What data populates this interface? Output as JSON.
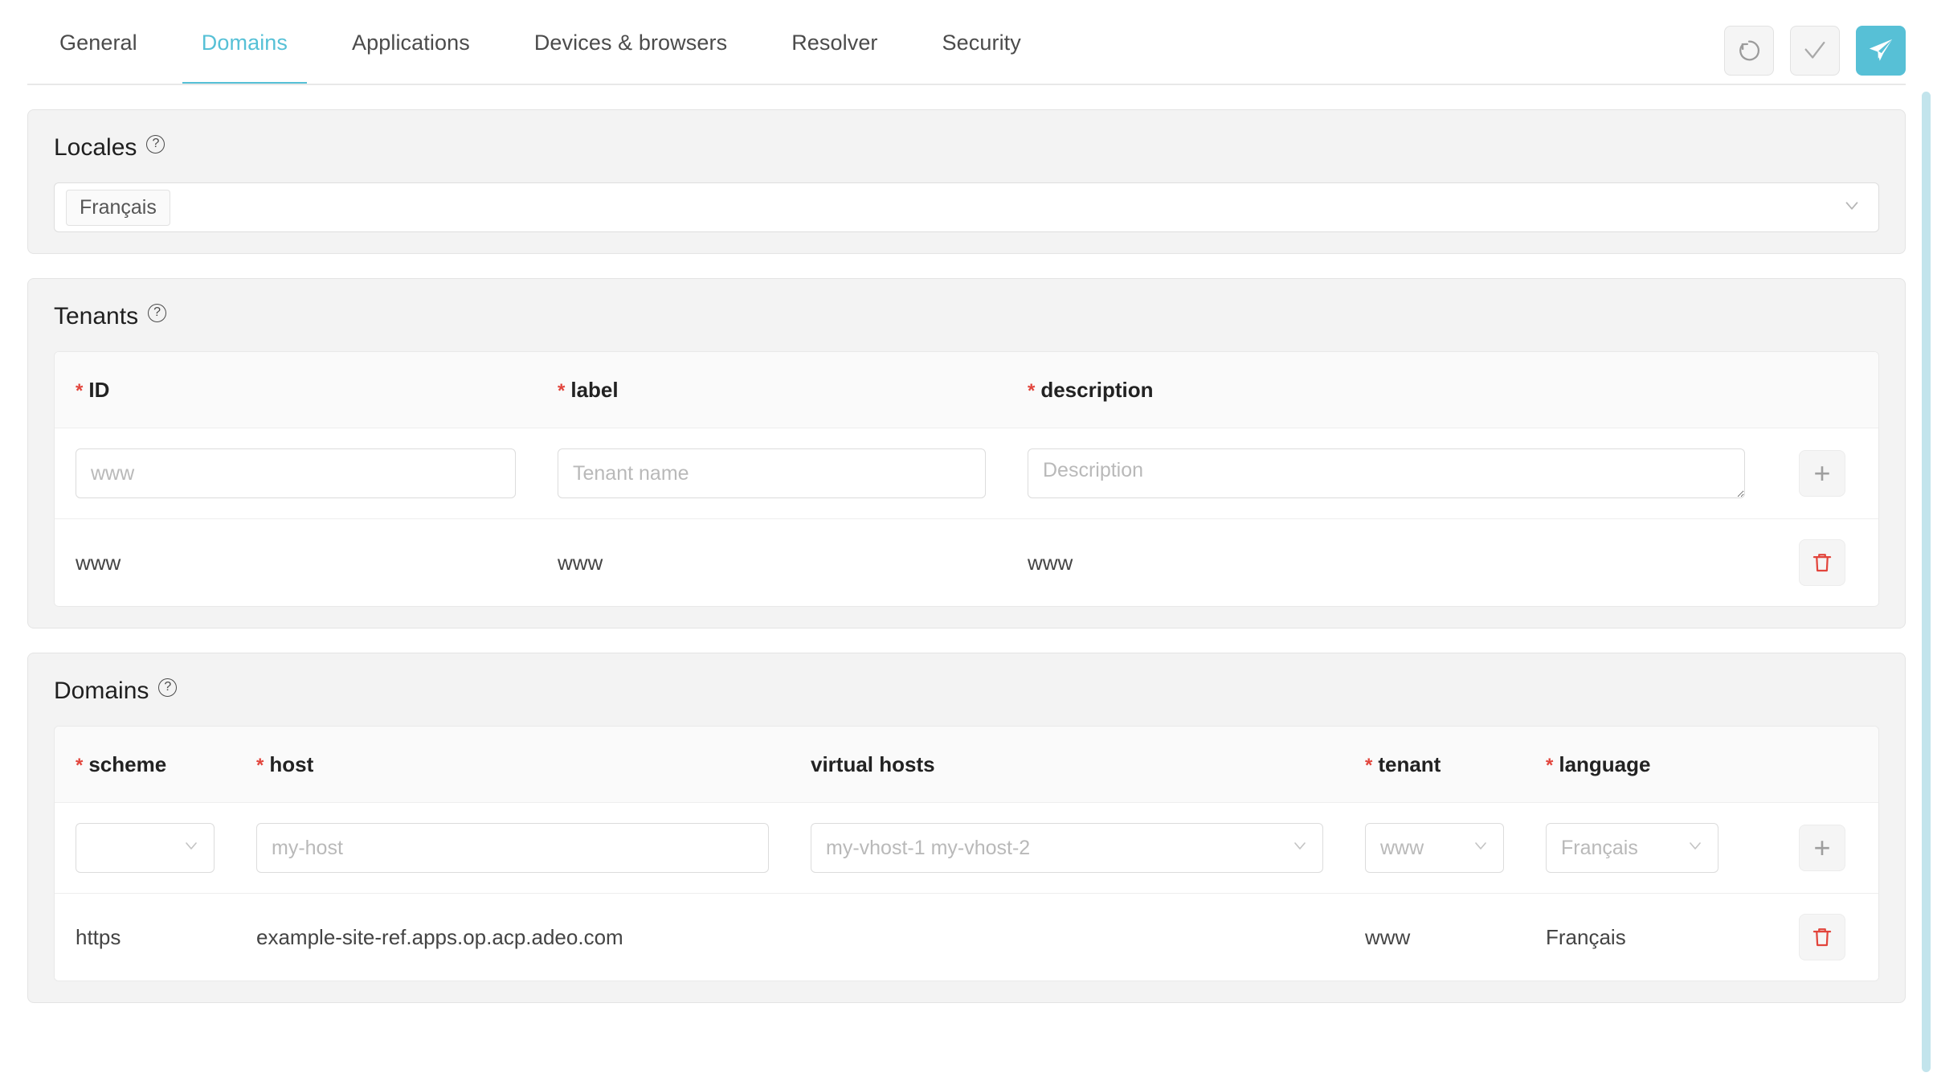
{
  "tabs": [
    {
      "label": "General",
      "active": false
    },
    {
      "label": "Domains",
      "active": true
    },
    {
      "label": "Applications",
      "active": false
    },
    {
      "label": "Devices & browsers",
      "active": false
    },
    {
      "label": "Resolver",
      "active": false
    },
    {
      "label": "Security",
      "active": false
    }
  ],
  "header_actions": [
    {
      "name": "reset-button",
      "icon": "refresh-icon"
    },
    {
      "name": "validate-button",
      "icon": "check-icon"
    },
    {
      "name": "publish-button",
      "icon": "send-icon"
    }
  ],
  "colors": {
    "accent": "#56c0d6",
    "required": "#e2453c",
    "delete": "#e2453c",
    "panel_bg": "#f3f3f3",
    "scrollbar": "#c2e4ec"
  },
  "locales": {
    "title": "Locales",
    "help": "?",
    "selected": [
      "Français"
    ]
  },
  "tenants": {
    "title": "Tenants",
    "help": "?",
    "columns": [
      {
        "label": "ID",
        "required": true
      },
      {
        "label": "label",
        "required": true
      },
      {
        "label": "description",
        "required": true
      }
    ],
    "form": {
      "id_placeholder": "www",
      "id_value": "",
      "label_placeholder": "Tenant name",
      "label_value": "",
      "description_placeholder": "Description",
      "description_value": "",
      "add_label": "+"
    },
    "rows": [
      {
        "id": "www",
        "label": "www",
        "description": "www"
      }
    ]
  },
  "domains": {
    "title": "Domains",
    "help": "?",
    "columns": [
      {
        "label": "scheme",
        "required": true
      },
      {
        "label": "host",
        "required": true
      },
      {
        "label": "virtual hosts",
        "required": false
      },
      {
        "label": "tenant",
        "required": true
      },
      {
        "label": "language",
        "required": true
      }
    ],
    "form": {
      "scheme_value": "",
      "host_placeholder": "my-host",
      "host_value": "",
      "vhosts_placeholder": "my-vhost-1 my-vhost-2",
      "tenant_placeholder": "www",
      "language_placeholder": "Français",
      "add_label": "+"
    },
    "rows": [
      {
        "scheme": "https",
        "host": "example-site-ref.apps.op.acp.adeo.com",
        "vhosts": "",
        "tenant": "www",
        "language": "Français"
      }
    ]
  }
}
